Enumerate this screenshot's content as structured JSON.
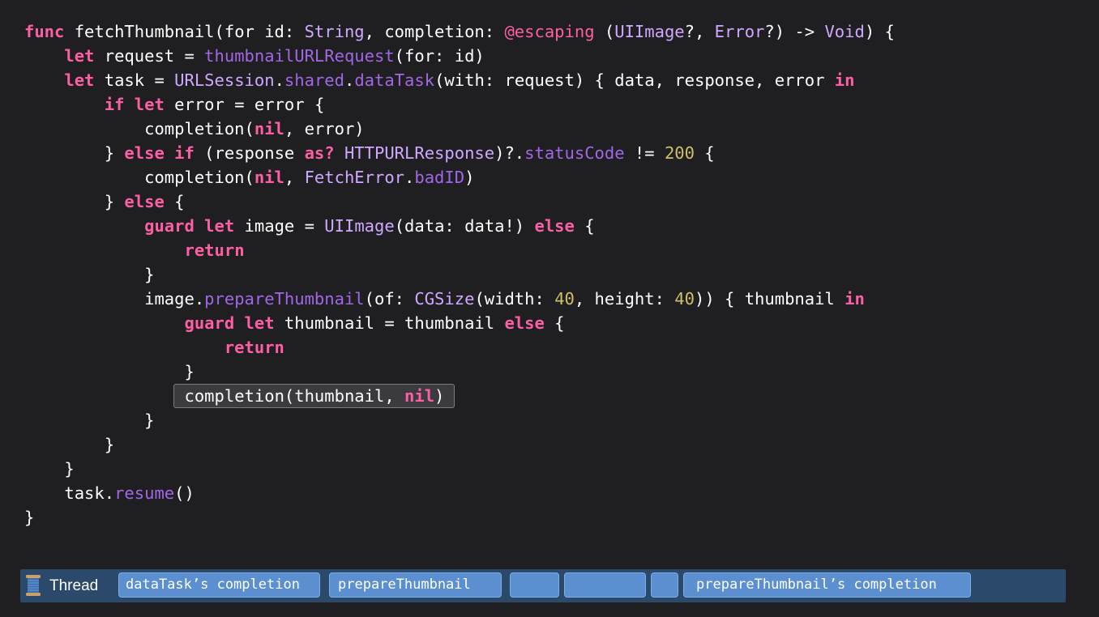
{
  "code": {
    "lines": [
      [
        {
          "t": "func",
          "c": "kw"
        },
        {
          "t": " fetchThumbnail(for id: ",
          "c": "pl"
        },
        {
          "t": "String",
          "c": "ty"
        },
        {
          "t": ", completion: ",
          "c": "pl"
        },
        {
          "t": "@escaping",
          "c": "attr"
        },
        {
          "t": " (",
          "c": "pl"
        },
        {
          "t": "UIImage",
          "c": "ty"
        },
        {
          "t": "?, ",
          "c": "pl"
        },
        {
          "t": "Error",
          "c": "ty"
        },
        {
          "t": "?) -> ",
          "c": "pl"
        },
        {
          "t": "Void",
          "c": "ty"
        },
        {
          "t": ") {",
          "c": "pl"
        }
      ],
      [
        {
          "t": "    ",
          "c": "pl"
        },
        {
          "t": "let",
          "c": "kw"
        },
        {
          "t": " request = ",
          "c": "pl"
        },
        {
          "t": "thumbnailURLRequest",
          "c": "fn"
        },
        {
          "t": "(for: id)",
          "c": "pl"
        }
      ],
      [
        {
          "t": "    ",
          "c": "pl"
        },
        {
          "t": "let",
          "c": "kw"
        },
        {
          "t": " task = ",
          "c": "pl"
        },
        {
          "t": "URLSession",
          "c": "ty"
        },
        {
          "t": ".",
          "c": "pl"
        },
        {
          "t": "shared",
          "c": "fn"
        },
        {
          "t": ".",
          "c": "pl"
        },
        {
          "t": "dataTask",
          "c": "fn"
        },
        {
          "t": "(with: request) { data, response, error ",
          "c": "pl"
        },
        {
          "t": "in",
          "c": "kw"
        }
      ],
      [
        {
          "t": "        ",
          "c": "pl"
        },
        {
          "t": "if",
          "c": "kw"
        },
        {
          "t": " ",
          "c": "pl"
        },
        {
          "t": "let",
          "c": "kw"
        },
        {
          "t": " error = error {",
          "c": "pl"
        }
      ],
      [
        {
          "t": "            completion(",
          "c": "pl"
        },
        {
          "t": "nil",
          "c": "kw"
        },
        {
          "t": ", error)",
          "c": "pl"
        }
      ],
      [
        {
          "t": "        } ",
          "c": "pl"
        },
        {
          "t": "else",
          "c": "kw"
        },
        {
          "t": " ",
          "c": "pl"
        },
        {
          "t": "if",
          "c": "kw"
        },
        {
          "t": " (response ",
          "c": "pl"
        },
        {
          "t": "as?",
          "c": "kw"
        },
        {
          "t": " ",
          "c": "pl"
        },
        {
          "t": "HTTPURLResponse",
          "c": "ty"
        },
        {
          "t": ")?.",
          "c": "pl"
        },
        {
          "t": "statusCode",
          "c": "fn"
        },
        {
          "t": " != ",
          "c": "pl"
        },
        {
          "t": "200",
          "c": "num"
        },
        {
          "t": " {",
          "c": "pl"
        }
      ],
      [
        {
          "t": "            completion(",
          "c": "pl"
        },
        {
          "t": "nil",
          "c": "kw"
        },
        {
          "t": ", ",
          "c": "pl"
        },
        {
          "t": "FetchError",
          "c": "ty"
        },
        {
          "t": ".",
          "c": "pl"
        },
        {
          "t": "badID",
          "c": "fn"
        },
        {
          "t": ")",
          "c": "pl"
        }
      ],
      [
        {
          "t": "        } ",
          "c": "pl"
        },
        {
          "t": "else",
          "c": "kw"
        },
        {
          "t": " {",
          "c": "pl"
        }
      ],
      [
        {
          "t": "            ",
          "c": "pl"
        },
        {
          "t": "guard",
          "c": "kw"
        },
        {
          "t": " ",
          "c": "pl"
        },
        {
          "t": "let",
          "c": "kw"
        },
        {
          "t": " image = ",
          "c": "pl"
        },
        {
          "t": "UIImage",
          "c": "ty"
        },
        {
          "t": "(data: data!) ",
          "c": "pl"
        },
        {
          "t": "else",
          "c": "kw"
        },
        {
          "t": " {",
          "c": "pl"
        }
      ],
      [
        {
          "t": "                ",
          "c": "pl"
        },
        {
          "t": "return",
          "c": "kw"
        }
      ],
      [
        {
          "t": "            }",
          "c": "pl"
        }
      ],
      [
        {
          "t": "            image.",
          "c": "pl"
        },
        {
          "t": "prepareThumbnail",
          "c": "fn"
        },
        {
          "t": "(of: ",
          "c": "pl"
        },
        {
          "t": "CGSize",
          "c": "ty"
        },
        {
          "t": "(width: ",
          "c": "pl"
        },
        {
          "t": "40",
          "c": "num"
        },
        {
          "t": ", height: ",
          "c": "pl"
        },
        {
          "t": "40",
          "c": "num"
        },
        {
          "t": ")) { thumbnail ",
          "c": "pl"
        },
        {
          "t": "in",
          "c": "kw"
        }
      ],
      [
        {
          "t": "                ",
          "c": "pl"
        },
        {
          "t": "guard",
          "c": "kw"
        },
        {
          "t": " ",
          "c": "pl"
        },
        {
          "t": "let",
          "c": "kw"
        },
        {
          "t": " thumbnail = thumbnail ",
          "c": "pl"
        },
        {
          "t": "else",
          "c": "kw"
        },
        {
          "t": " {",
          "c": "pl"
        }
      ],
      [
        {
          "t": "                    ",
          "c": "pl"
        },
        {
          "t": "return",
          "c": "kw"
        }
      ],
      [
        {
          "t": "                }",
          "c": "pl"
        }
      ],
      [
        {
          "t": "                ",
          "c": "pl"
        },
        {
          "t": "completion(thumbnail, ",
          "c": "pl hl-start"
        },
        {
          "t": "nil",
          "c": "kw hl-mid"
        },
        {
          "t": ")",
          "c": "pl hl-end"
        }
      ],
      [
        {
          "t": "            }",
          "c": "pl"
        }
      ],
      [
        {
          "t": "        }",
          "c": "pl"
        }
      ],
      [
        {
          "t": "    }",
          "c": "pl"
        }
      ],
      [
        {
          "t": "    task.",
          "c": "pl"
        },
        {
          "t": "resume",
          "c": "fn"
        },
        {
          "t": "()",
          "c": "pl"
        }
      ],
      [
        {
          "t": "}",
          "c": "pl"
        }
      ]
    ]
  },
  "thread_bar": {
    "label": "Thread",
    "icon": "spool-of-thread-icon",
    "segments": [
      {
        "label": "dataTask’s completion"
      },
      {
        "label": "prepareThumbnail"
      },
      {
        "label": ""
      },
      {
        "label": ""
      },
      {
        "label": ""
      },
      {
        "label": "prepareThumbnail’s completion"
      }
    ]
  },
  "colors": {
    "background": "#1f1f22",
    "keyword": "#fc5fa3",
    "type": "#d0a8ff",
    "function": "#a167e6",
    "number": "#d0bf69",
    "thread_bar": "#2b4a6b",
    "segment": "#5b8fcf"
  }
}
